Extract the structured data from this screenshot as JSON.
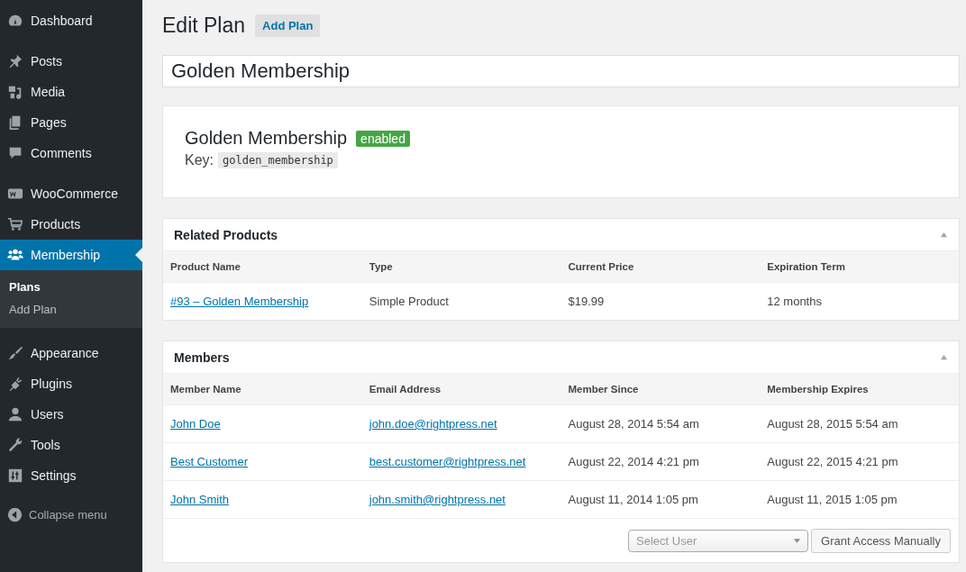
{
  "sidebar": {
    "groups": [
      [
        {
          "label": "Dashboard",
          "selected": false
        }
      ],
      [
        {
          "label": "Posts",
          "selected": false
        },
        {
          "label": "Media",
          "selected": false
        },
        {
          "label": "Pages",
          "selected": false
        },
        {
          "label": "Comments",
          "selected": false
        }
      ],
      [
        {
          "label": "WooCommerce",
          "selected": false
        },
        {
          "label": "Products",
          "selected": false
        },
        {
          "label": "Membership",
          "selected": true,
          "children": [
            {
              "label": "Plans",
              "selected": true
            },
            {
              "label": "Add Plan",
              "selected": false
            }
          ]
        }
      ],
      [
        {
          "label": "Appearance",
          "selected": false
        },
        {
          "label": "Plugins",
          "selected": false
        },
        {
          "label": "Users",
          "selected": false
        },
        {
          "label": "Tools",
          "selected": false
        },
        {
          "label": "Settings",
          "selected": false
        }
      ]
    ],
    "collapse": "Collapse menu"
  },
  "page": {
    "title": "Edit Plan",
    "action": "Add Plan"
  },
  "plan_title_input": {
    "value": "Golden Membership"
  },
  "summary": {
    "name": "Golden Membership",
    "status": "enabled",
    "key_label": "Key:",
    "key": "golden_membership"
  },
  "panels": [
    {
      "title": "Related Products",
      "columns": [
        "Product Name",
        "Type",
        "Current Price",
        "Expiration Term"
      ],
      "rows": [
        [
          {
            "text": "#93 – Golden Membership",
            "link": true
          },
          {
            "text": "Simple Product",
            "link": false
          },
          {
            "text": "$19.99",
            "link": false
          },
          {
            "text": "12 months",
            "link": false
          }
        ]
      ]
    },
    {
      "title": "Members",
      "columns": [
        "Member Name",
        "Email Address",
        "Member Since",
        "Membership Expires"
      ],
      "rows": [
        [
          {
            "text": "John Doe",
            "link": true
          },
          {
            "text": "john.doe@rightpress.net",
            "link": true
          },
          {
            "text": "August 28, 2014 5:54 am",
            "link": false
          },
          {
            "text": "August 28, 2015 5:54 am",
            "link": false
          }
        ],
        [
          {
            "text": "Best Customer",
            "link": true
          },
          {
            "text": "best.customer@rightpress.net",
            "link": true
          },
          {
            "text": "August 22, 2014 4:21 pm",
            "link": false
          },
          {
            "text": "August 22, 2015 4:21 pm",
            "link": false
          }
        ],
        [
          {
            "text": "John Smith",
            "link": true
          },
          {
            "text": "john.smith@rightpress.net",
            "link": true
          },
          {
            "text": "August 11, 2014 1:05 pm",
            "link": false
          },
          {
            "text": "August 11, 2015 1:05 pm",
            "link": false
          }
        ]
      ],
      "footer": {
        "select_placeholder": "Select User",
        "button": "Grant Access Manually"
      }
    }
  ]
}
